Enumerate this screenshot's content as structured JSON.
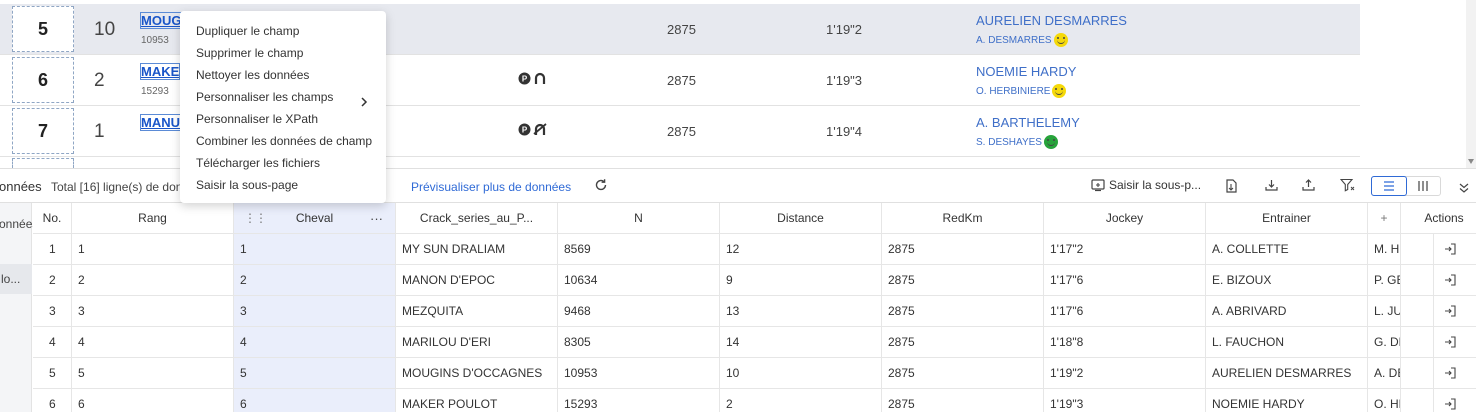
{
  "preview": {
    "rows": [
      {
        "rank": "5",
        "n": "10",
        "name": "MOUG",
        "id": "10953",
        "distance": "2875",
        "redkm": "1'19\"2",
        "jockey": "AURELIEN DESMARRES",
        "trainer": "A. DESMARRES",
        "mood": "yellow",
        "icons": [],
        "highlight": true
      },
      {
        "rank": "6",
        "n": "2",
        "name": "MAKE",
        "id": "15293",
        "distance": "2875",
        "redkm": "1'19\"3",
        "jockey": "NOEMIE HARDY",
        "trainer": "O. HERBINIERE",
        "mood": "yellow",
        "icons": [
          "parking-icon",
          "horseshoe-icon"
        ],
        "highlight": false
      },
      {
        "rank": "7",
        "n": "1",
        "name": "MANU",
        "id": "",
        "distance": "2875",
        "redkm": "1'19\"4",
        "jockey": "A. BARTHELEMY",
        "trainer": "S. DESHAYES",
        "mood": "green",
        "icons": [
          "parking-icon",
          "no-horseshoe-icon"
        ],
        "highlight": false
      }
    ]
  },
  "context_menu": {
    "items": [
      {
        "label": "Dupliquer le champ",
        "submenu": false
      },
      {
        "label": "Supprimer le champ",
        "submenu": false
      },
      {
        "label": "Nettoyer les données",
        "submenu": false
      },
      {
        "label": "Personnaliser les champs",
        "submenu": true
      },
      {
        "label": "Personnaliser le XPath",
        "submenu": false
      },
      {
        "label": "Combiner les données de champ",
        "submenu": false
      },
      {
        "label": "Télécharger les fichiers",
        "submenu": false
      },
      {
        "label": "Saisir la sous-page",
        "submenu": false
      }
    ]
  },
  "toolbar": {
    "title": "onnées",
    "total": "Total [16] ligne(s) de don",
    "preview_more": "Prévisualiser plus de données",
    "subpage": "Saisir la sous-p..."
  },
  "left_strip": {
    "item1": "onnées",
    "item2": "lo..."
  },
  "grid": {
    "headers": [
      "No.",
      "Rang",
      "Cheval",
      "Crack_series_au_P...",
      "N",
      "Distance",
      "RedKm",
      "Jockey",
      "Entrainer",
      "+",
      "Actions"
    ],
    "rows": [
      [
        "1",
        "1",
        "MY SUN DRALIAM",
        "8569",
        "12",
        "2875",
        "1'17\"2",
        "A. COLLETTE",
        "M. HELBERT"
      ],
      [
        "2",
        "2",
        "MANON D'EPOC",
        "10634",
        "9",
        "2875",
        "1'17\"6",
        "E. BIZOUX",
        "P. GENDRY"
      ],
      [
        "3",
        "3",
        "MEZQUITA",
        "9468",
        "13",
        "2875",
        "1'17\"6",
        "A. ABRIVARD",
        "L. JUBLOT"
      ],
      [
        "4",
        "4",
        "MARILOU D'ERI",
        "8305",
        "14",
        "2875",
        "1'18\"8",
        "L. FAUCHON",
        "G. DELACOUR"
      ],
      [
        "5",
        "5",
        "MOUGINS D'OCCAGNES",
        "10953",
        "10",
        "2875",
        "1'19\"2",
        "AURELIEN DESMARRES",
        "A. DESMARRES"
      ],
      [
        "6",
        "6",
        "MAKER POULOT",
        "15293",
        "2",
        "2875",
        "1'19\"3",
        "NOEMIE HARDY",
        "O. HERBINIERE"
      ]
    ]
  },
  "colors": {
    "accent": "#2f6ad6",
    "selected_column": "#eaeefb",
    "row_highlight": "#e7e9ef"
  }
}
